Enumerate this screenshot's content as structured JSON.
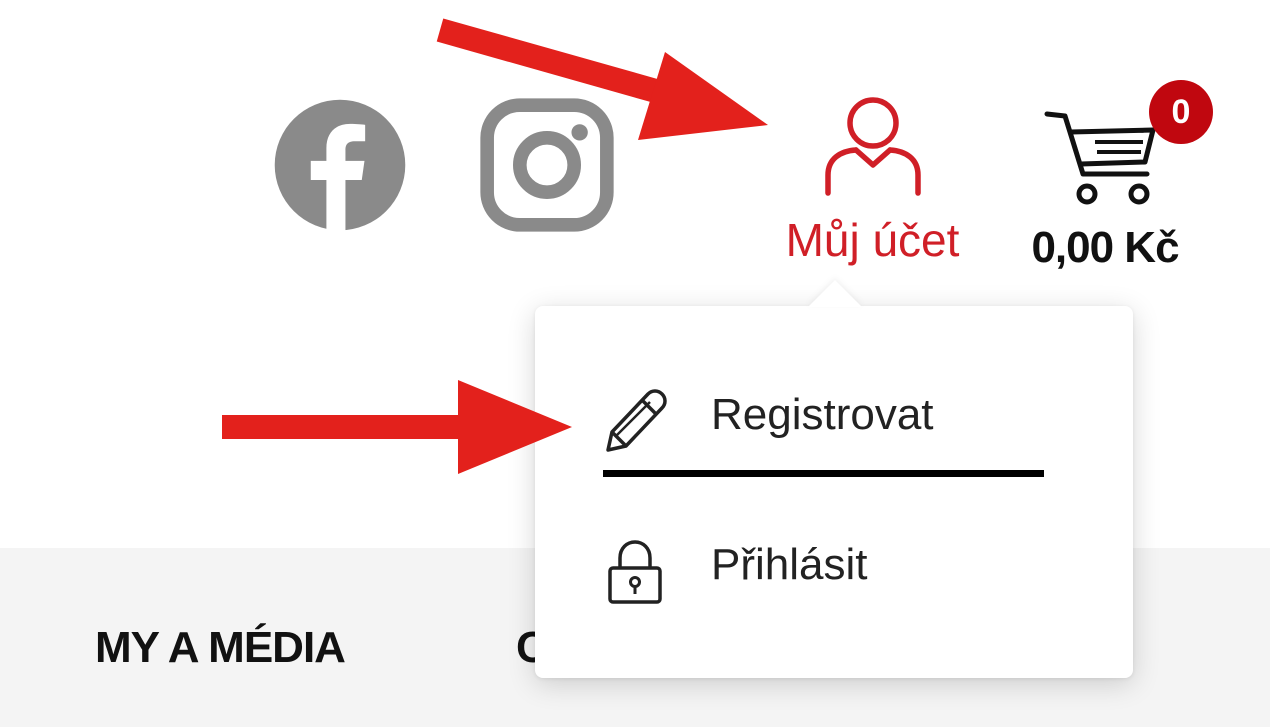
{
  "header": {
    "social": [
      {
        "name": "facebook-icon"
      },
      {
        "name": "instagram-icon"
      }
    ],
    "account": {
      "label": "Můj účet",
      "color": "#d01f27"
    },
    "cart": {
      "badge_count": "0",
      "total": "0,00 Kč",
      "badge_color": "#c0070f"
    }
  },
  "dropdown": {
    "items": [
      {
        "label": "Registrovat",
        "icon": "pencil-icon"
      },
      {
        "label": "Přihlásit",
        "icon": "lock-icon"
      }
    ]
  },
  "nav": {
    "items": [
      {
        "label": "MY A MÉDIA"
      },
      {
        "label": "C"
      }
    ]
  },
  "annotations": {
    "arrow_color": "#e3211c"
  }
}
